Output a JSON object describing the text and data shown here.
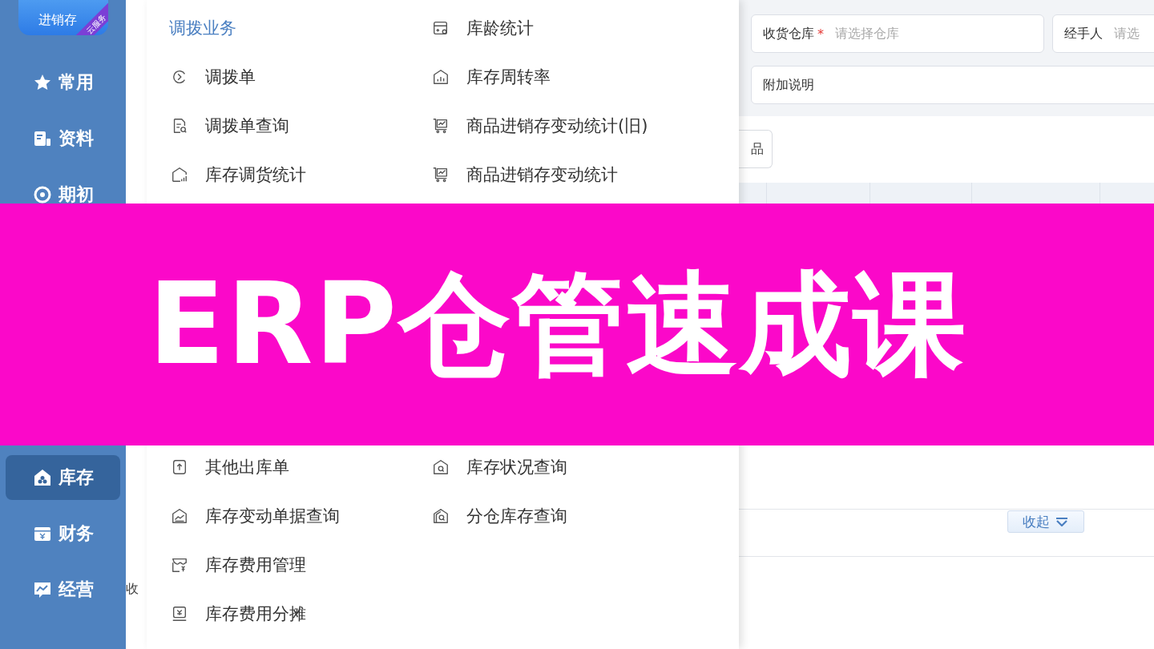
{
  "sidebar": {
    "logo": {
      "text": "进销存",
      "tag": "云服务"
    },
    "upper_items": [
      {
        "label": "常用",
        "selected": false
      },
      {
        "label": "资料",
        "selected": false
      },
      {
        "label": "期初",
        "selected": false
      }
    ],
    "lower_items": [
      {
        "label": "库存",
        "selected": true
      },
      {
        "label": "财务",
        "selected": false
      },
      {
        "label": "经营",
        "selected": false
      }
    ]
  },
  "strip_labels": [
    "收"
  ],
  "form": {
    "rows": [
      [
        {
          "label": "收货仓库",
          "required_mark": "*",
          "placeholder": "请选择仓库"
        },
        {
          "label": "经手人",
          "placeholder": "请选"
        }
      ],
      [
        {
          "label": "附加说明"
        }
      ]
    ]
  },
  "product_button": "品",
  "collapse_button": "收起",
  "menu": {
    "upper": {
      "left": [
        {
          "kind": "heading",
          "label": "调拨业务"
        },
        {
          "kind": "link",
          "label": "调拨单"
        },
        {
          "kind": "link",
          "label": "调拨单查询"
        },
        {
          "kind": "link",
          "label": "库存调货统计"
        }
      ],
      "right": [
        {
          "kind": "link",
          "label": "库龄统计"
        },
        {
          "kind": "link",
          "label": "库存周转率"
        },
        {
          "kind": "link",
          "label": "商品进销存变动统计(旧)"
        },
        {
          "kind": "link",
          "label": "商品进销存变动统计"
        }
      ]
    },
    "lower": {
      "left": [
        {
          "kind": "link",
          "label": "其他出库单"
        },
        {
          "kind": "link",
          "label": "库存变动单据查询"
        },
        {
          "kind": "link",
          "label": "库存费用管理"
        },
        {
          "kind": "link",
          "label": "库存费用分摊"
        }
      ],
      "right": [
        {
          "kind": "link",
          "label": "库存状况查询"
        },
        {
          "kind": "link",
          "label": "分仓库存查询"
        }
      ]
    }
  },
  "banner": {
    "title": "ERP仓管速成课"
  }
}
